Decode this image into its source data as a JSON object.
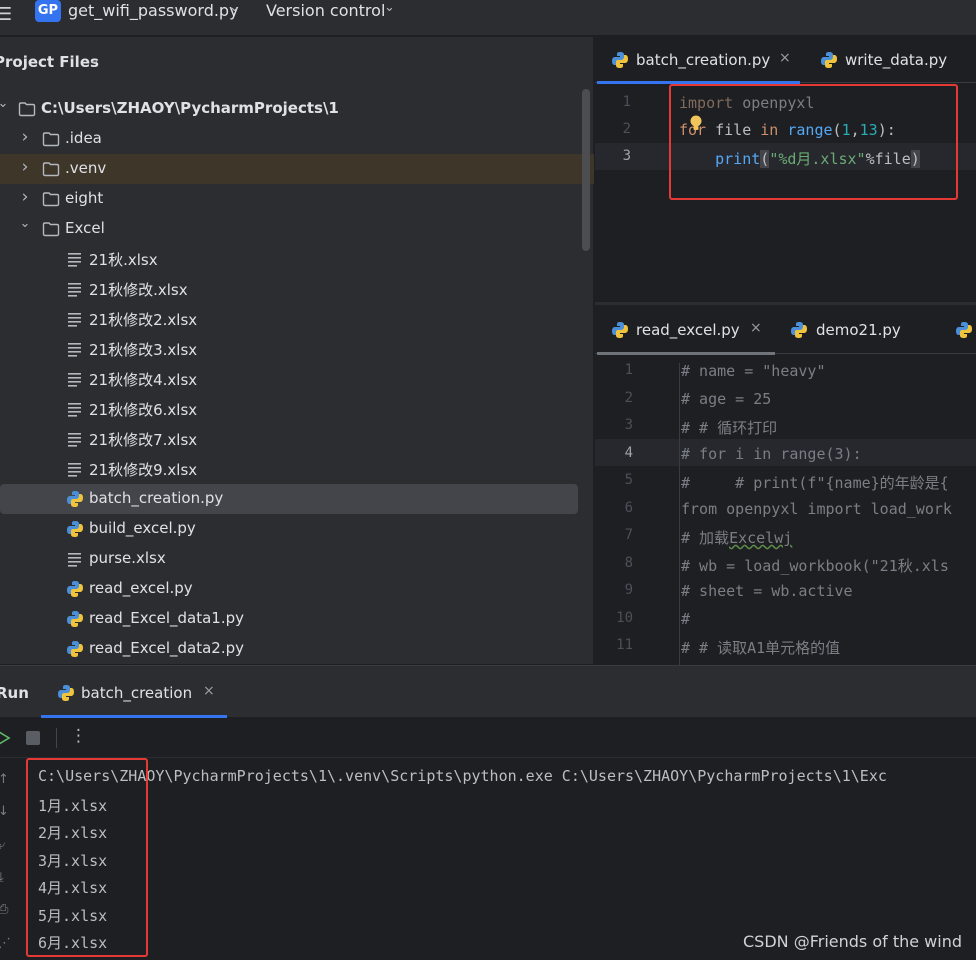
{
  "topbar": {
    "project_badge": "GP",
    "project_name": "get_wifi_password.py",
    "version_control": "Version control"
  },
  "project_panel": {
    "title": "Project Files",
    "items": [
      {
        "label": "C:\\Users\\ZHAOY\\PycharmProjects\\1",
        "type": "folder",
        "arrow": "expanded",
        "bold": true
      },
      {
        "label": ".idea",
        "type": "folder",
        "arrow": "collapsed"
      },
      {
        "label": ".venv",
        "type": "folder",
        "arrow": "collapsed"
      },
      {
        "label": "eight",
        "type": "folder",
        "arrow": "collapsed"
      },
      {
        "label": "Excel",
        "type": "folder",
        "arrow": "expanded"
      },
      {
        "label": "21秋.xlsx",
        "type": "file"
      },
      {
        "label": "21秋修改.xlsx",
        "type": "file"
      },
      {
        "label": "21秋修改2.xlsx",
        "type": "file"
      },
      {
        "label": "21秋修改3.xlsx",
        "type": "file"
      },
      {
        "label": "21秋修改4.xlsx",
        "type": "file"
      },
      {
        "label": "21秋修改6.xlsx",
        "type": "file"
      },
      {
        "label": "21秋修改7.xlsx",
        "type": "file"
      },
      {
        "label": "21秋修改9.xlsx",
        "type": "file"
      },
      {
        "label": "batch_creation.py",
        "type": "python"
      },
      {
        "label": "build_excel.py",
        "type": "python"
      },
      {
        "label": "purse.xlsx",
        "type": "file"
      },
      {
        "label": "read_excel.py",
        "type": "python"
      },
      {
        "label": "read_Excel_data1.py",
        "type": "python"
      },
      {
        "label": "read_Excel_data2.py",
        "type": "python"
      }
    ]
  },
  "editor_top": {
    "tabs": [
      {
        "label": "batch_creation.py",
        "close": "×"
      },
      {
        "label": "write_data.py"
      }
    ],
    "line_numbers": [
      "1",
      "2",
      "3"
    ]
  },
  "editor_bottom": {
    "tabs": [
      {
        "label": "read_excel.py",
        "close": "×"
      },
      {
        "label": "demo21.py"
      }
    ],
    "line_numbers": [
      "1",
      "2",
      "3",
      "4",
      "5",
      "6",
      "7",
      "8",
      "9",
      "10",
      "11"
    ],
    "lines": [
      "# name = \"heavy\"",
      "# age = 25",
      "# # 循环打印",
      "# for i in range(3):",
      "#     # print(f\"{name}的年龄是{",
      "from openpyxl import load_work",
      "# 加载Excelwj",
      "# wb = load_workbook(\"21秋.xls",
      "# sheet = wb.active",
      "#",
      "# # 读取A1单元格的值"
    ]
  },
  "run_panel": {
    "title": "Run",
    "tab_label": "batch_creation",
    "tab_close": "×",
    "console": [
      "C:\\Users\\ZHAOY\\PycharmProjects\\1\\.venv\\Scripts\\python.exe C:\\Users\\ZHAOY\\PycharmProjects\\1\\Exc",
      "1月.xlsx",
      "2月.xlsx",
      "3月.xlsx",
      "4月.xlsx",
      "5月.xlsx",
      "6月.xlsx"
    ]
  },
  "watermark": "CSDN @Friends of the wind",
  "colors": {
    "accent": "#3574f0",
    "annotation_red": "#e53935",
    "keyword": "#cf8e6d",
    "function": "#56a8f5",
    "number": "#2aacb8",
    "string": "#6aab73"
  }
}
